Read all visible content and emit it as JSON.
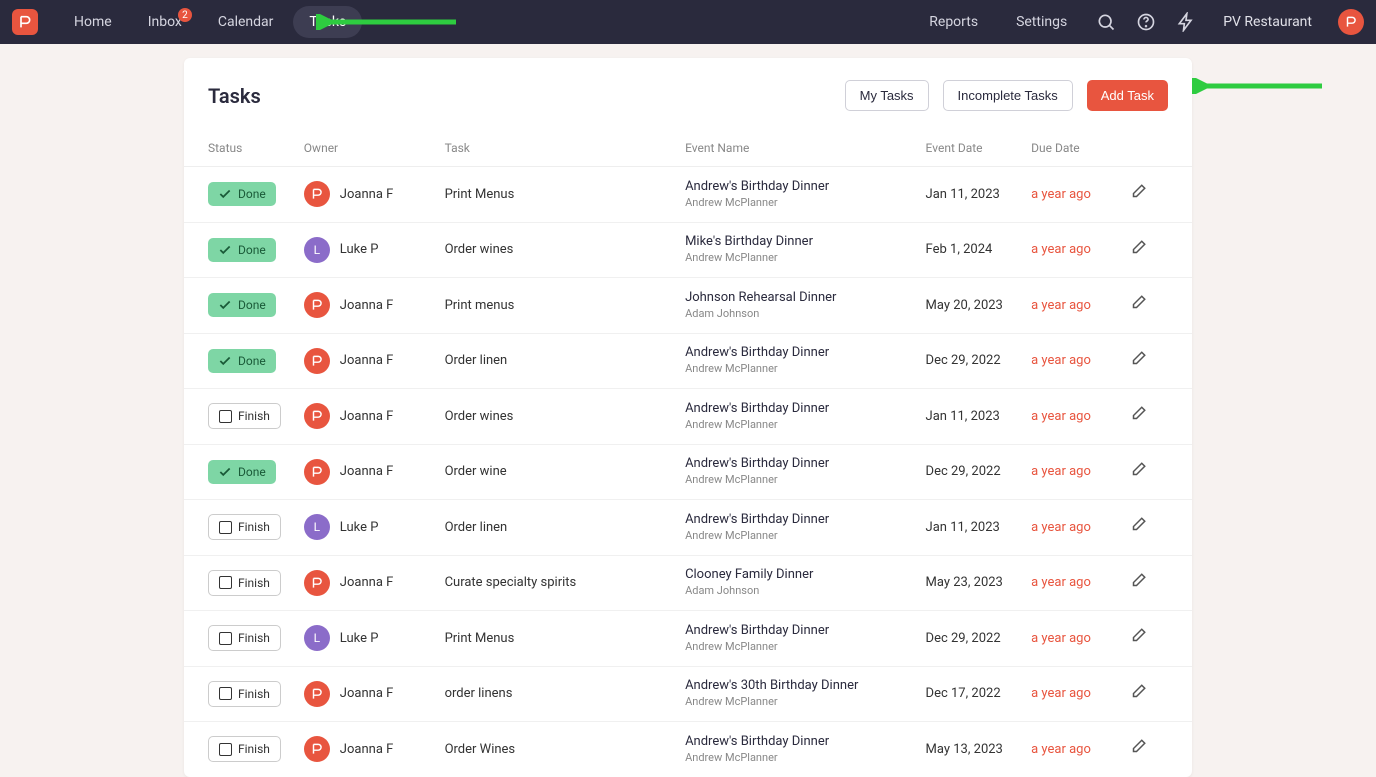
{
  "nav": {
    "home": "Home",
    "inbox": "Inbox",
    "inbox_badge": "2",
    "calendar": "Calendar",
    "tasks": "Tasks",
    "reports": "Reports",
    "settings": "Settings",
    "company": "PV Restaurant"
  },
  "page": {
    "title": "Tasks",
    "my_tasks": "My Tasks",
    "incomplete": "Incomplete Tasks",
    "add_task": "Add Task"
  },
  "columns": {
    "status": "Status",
    "owner": "Owner",
    "task": "Task",
    "event": "Event Name",
    "date": "Event Date",
    "due": "Due Date"
  },
  "rows": [
    {
      "status": "Done",
      "done": true,
      "avatar": "red",
      "owner": "Joanna F",
      "task": "Print Menus",
      "event": "Andrew's Birthday Dinner",
      "person": "Andrew McPlanner",
      "date": "Jan 11, 2023",
      "due": "a year ago"
    },
    {
      "status": "Done",
      "done": true,
      "avatar": "purple",
      "initial": "L",
      "owner": "Luke P",
      "task": "Order wines",
      "event": "Mike's Birthday Dinner",
      "person": "Andrew McPlanner",
      "date": "Feb 1, 2024",
      "due": "a year ago"
    },
    {
      "status": "Done",
      "done": true,
      "avatar": "red",
      "owner": "Joanna F",
      "task": "Print menus",
      "event": "Johnson Rehearsal Dinner",
      "person": "Adam Johnson",
      "date": "May 20, 2023",
      "due": "a year ago"
    },
    {
      "status": "Done",
      "done": true,
      "avatar": "red",
      "owner": "Joanna F",
      "task": "Order linen",
      "event": "Andrew's Birthday Dinner",
      "person": "Andrew McPlanner",
      "date": "Dec 29, 2022",
      "due": "a year ago"
    },
    {
      "status": "Finish",
      "done": false,
      "avatar": "red",
      "owner": "Joanna F",
      "task": "Order wines",
      "event": "Andrew's Birthday Dinner",
      "person": "Andrew McPlanner",
      "date": "Jan 11, 2023",
      "due": "a year ago"
    },
    {
      "status": "Done",
      "done": true,
      "avatar": "red",
      "owner": "Joanna F",
      "task": "Order wine",
      "event": "Andrew's Birthday Dinner",
      "person": "Andrew McPlanner",
      "date": "Dec 29, 2022",
      "due": "a year ago"
    },
    {
      "status": "Finish",
      "done": false,
      "avatar": "purple",
      "initial": "L",
      "owner": "Luke P",
      "task": "Order linen",
      "event": "Andrew's Birthday Dinner",
      "person": "Andrew McPlanner",
      "date": "Jan 11, 2023",
      "due": "a year ago"
    },
    {
      "status": "Finish",
      "done": false,
      "avatar": "red",
      "owner": "Joanna F",
      "task": "Curate specialty spirits",
      "event": "Clooney Family Dinner",
      "person": "Adam Johnson",
      "date": "May 23, 2023",
      "due": "a year ago"
    },
    {
      "status": "Finish",
      "done": false,
      "avatar": "purple",
      "initial": "L",
      "owner": "Luke P",
      "task": "Print Menus",
      "event": "Andrew's Birthday Dinner",
      "person": "Andrew McPlanner",
      "date": "Dec 29, 2022",
      "due": "a year ago"
    },
    {
      "status": "Finish",
      "done": false,
      "avatar": "red",
      "owner": "Joanna F",
      "task": "order linens",
      "event": "Andrew's 30th Birthday Dinner",
      "person": "Andrew McPlanner",
      "date": "Dec 17, 2022",
      "due": "a year ago"
    },
    {
      "status": "Finish",
      "done": false,
      "avatar": "red",
      "owner": "Joanna F",
      "task": "Order Wines",
      "event": "Andrew's Birthday Dinner",
      "person": "Andrew McPlanner",
      "date": "May 13, 2023",
      "due": "a year ago"
    }
  ]
}
